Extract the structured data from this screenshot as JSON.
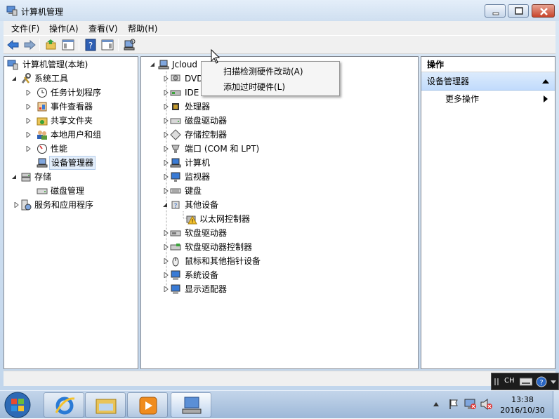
{
  "window": {
    "title": "计算机管理"
  },
  "menubar": {
    "items": [
      "文件(F)",
      "操作(A)",
      "查看(V)",
      "帮助(H)"
    ]
  },
  "left_tree": {
    "root": "计算机管理(本地)",
    "system_tools": "系统工具",
    "task_scheduler": "任务计划程序",
    "event_viewer": "事件查看器",
    "shared_folders": "共享文件夹",
    "local_users": "本地用户和组",
    "performance": "性能",
    "device_manager": "设备管理器",
    "storage": "存储",
    "disk_management": "磁盘管理",
    "services_apps": "服务和应用程序"
  },
  "device_tree": {
    "root": "Jcloud",
    "items": [
      "DVD",
      "IDE",
      "处理器",
      "磁盘驱动器",
      "存储控制器",
      "端口 (COM 和 LPT)",
      "计算机",
      "监视器",
      "键盘",
      "其他设备",
      "以太网控制器",
      "软盘驱动器",
      "软盘驱动器控制器",
      "鼠标和其他指针设备",
      "系统设备",
      "显示适配器"
    ]
  },
  "context_menu": {
    "items": [
      "扫描检测硬件改动(A)",
      "添加过时硬件(L)"
    ]
  },
  "actions": {
    "header": "操作",
    "section": "设备管理器",
    "more": "更多操作"
  },
  "langbar": {
    "label": "CH"
  },
  "clock": {
    "time": "13:38",
    "date": "2016/10/30"
  },
  "colors": {
    "accent": "#3399ff",
    "selection": "#e3eefb",
    "title_bg": "#dbe8f5"
  }
}
